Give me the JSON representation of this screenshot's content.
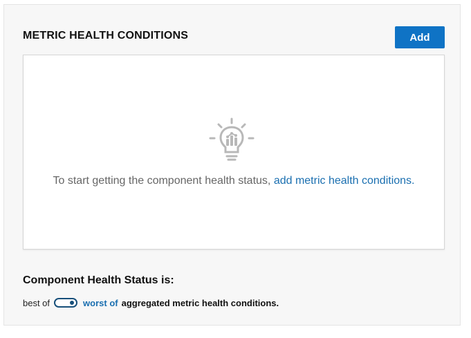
{
  "metric_conditions": {
    "title": "METRIC HEALTH CONDITIONS",
    "add_label": "Add",
    "empty_state": {
      "icon": "lightbulb-chart-icon",
      "message": "To start getting the component health status, ",
      "link_text": "add metric health conditions."
    }
  },
  "health_status": {
    "heading": "Component Health Status is:",
    "option_off": "best of",
    "option_on": "worst of",
    "suffix": "aggregated metric health conditions.",
    "toggle_selected": "worst of"
  },
  "colors": {
    "accent": "#0f73c5",
    "link": "#1a6fb0",
    "toggle": "#174f7a",
    "panel_bg": "#f7f7f7"
  }
}
